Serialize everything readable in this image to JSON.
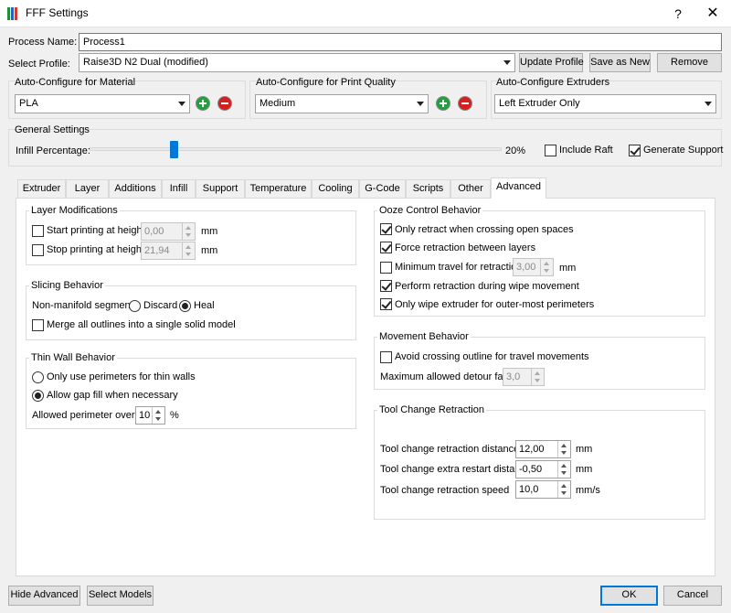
{
  "window": {
    "title": "FFF Settings",
    "help_label": "?",
    "close_label": "✕",
    "app_icon": "simplify3d-icon",
    "icon_colors": [
      "#1f8f3a",
      "#2a63c7",
      "#d63a2a"
    ]
  },
  "header": {
    "process_name_label": "Process Name:",
    "process_name_value": "Process1",
    "select_profile_label": "Select Profile:",
    "profile_value": "Raise3D N2 Dual (modified)",
    "update_profile": "Update Profile",
    "save_as_new": "Save as New",
    "remove": "Remove"
  },
  "auto_configure": {
    "material": {
      "title": "Auto-Configure for Material",
      "value": "PLA"
    },
    "quality": {
      "title": "Auto-Configure for Print Quality",
      "value": "Medium"
    },
    "extruders": {
      "title": "Auto-Configure Extruders",
      "value": "Left Extruder Only"
    }
  },
  "general": {
    "title": "General Settings",
    "infill_label": "Infill Percentage:",
    "infill_value": "20%",
    "infill_fraction": 0.2,
    "include_raft": "Include Raft",
    "include_raft_checked": false,
    "generate_support": "Generate Support",
    "generate_support_checked": true
  },
  "tabs": [
    {
      "label": "Extruder",
      "active": false
    },
    {
      "label": "Layer",
      "active": false
    },
    {
      "label": "Additions",
      "active": false
    },
    {
      "label": "Infill",
      "active": false
    },
    {
      "label": "Support",
      "active": false
    },
    {
      "label": "Temperature",
      "active": false
    },
    {
      "label": "Cooling",
      "active": false
    },
    {
      "label": "G-Code",
      "active": false
    },
    {
      "label": "Scripts",
      "active": false
    },
    {
      "label": "Other",
      "active": false
    },
    {
      "label": "Advanced",
      "active": true
    }
  ],
  "layer_mods": {
    "title": "Layer Modifications",
    "start_label": "Start printing at height",
    "start_value": "0,00",
    "start_unit": "mm",
    "stop_label": "Stop printing at height",
    "stop_value": "21,94",
    "stop_unit": "mm"
  },
  "slicing": {
    "title": "Slicing Behavior",
    "non_manifold_label": "Non-manifold segments:",
    "discard": "Discard",
    "heal": "Heal",
    "merge": "Merge all outlines into a single solid model"
  },
  "thin_wall": {
    "title": "Thin Wall Behavior",
    "only_perimeters": "Only use perimeters for thin walls",
    "allow_gap": "Allow gap fill when necessary",
    "overlap_label": "Allowed perimeter overlap",
    "overlap_value": "10",
    "overlap_unit": "%"
  },
  "ooze": {
    "title": "Ooze Control Behavior",
    "only_retract": "Only retract when crossing open spaces",
    "force_retraction": "Force retraction between layers",
    "min_travel": "Minimum travel for retraction",
    "min_travel_value": "3,00",
    "min_travel_unit": "mm",
    "perform_retraction": "Perform retraction during wipe movement",
    "only_wipe": "Only wipe extruder for outer-most perimeters"
  },
  "movement": {
    "title": "Movement Behavior",
    "avoid_crossing": "Avoid crossing outline for travel movements",
    "max_detour_label": "Maximum allowed detour factor",
    "max_detour_value": "3,0"
  },
  "tool_change": {
    "title": "Tool Change Retraction",
    "distance_label": "Tool change retraction distance",
    "distance_value": "12,00",
    "distance_unit": "mm",
    "extra_label": "Tool change extra restart distance",
    "extra_value": "-0,50",
    "extra_unit": "mm",
    "speed_label": "Tool change retraction speed",
    "speed_value": "10,0",
    "speed_unit": "mm/s"
  },
  "footer": {
    "hide_advanced": "Hide Advanced",
    "select_models": "Select Models",
    "ok": "OK",
    "cancel": "Cancel"
  }
}
